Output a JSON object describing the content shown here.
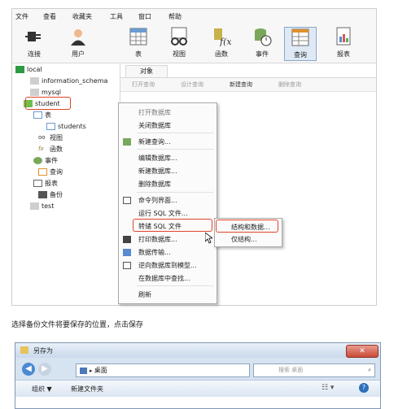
{
  "menubar": [
    "文件",
    "查看",
    "收藏夹",
    "工具",
    "窗口",
    "帮助"
  ],
  "toolbar": [
    {
      "label": "连接",
      "icon": "plug-icon"
    },
    {
      "label": "用户",
      "icon": "user-icon"
    },
    {
      "label": "表",
      "icon": "table-icon"
    },
    {
      "label": "视图",
      "icon": "view-icon"
    },
    {
      "label": "函数",
      "icon": "function-icon"
    },
    {
      "label": "事件",
      "icon": "event-icon"
    },
    {
      "label": "查询",
      "icon": "query-icon",
      "selected": true
    },
    {
      "label": "报表",
      "icon": "report-icon"
    }
  ],
  "tree": {
    "root": "local",
    "dbs": [
      "information_schema",
      "mysql",
      "student",
      "test"
    ],
    "student_children": [
      "表",
      "students",
      "视图",
      "函数",
      "事件",
      "查询",
      "报表",
      "备份"
    ]
  },
  "object_tab": "对象",
  "object_actions": [
    "打开查询",
    "设计查询",
    "新建查询",
    "删除查询"
  ],
  "context_menu": [
    "打开数据库",
    "关闭数据库",
    "新建查询...",
    "编辑数据库...",
    "新建数据库...",
    "删除数据库",
    "命令列界面...",
    "运行 SQL 文件...",
    "转储 SQL 文件",
    "打印数据库...",
    "数据传输...",
    "逆向数据库到模型...",
    "在数据库中查找...",
    "刷新"
  ],
  "submenu": [
    "结构和数据...",
    "仅结构..."
  ],
  "caption": "选择备份文件将要保存的位置，点击保存",
  "dialog": {
    "title": "另存为",
    "address": "桌面",
    "search_placeholder": "搜索 桌面",
    "organize": "组织 ▼",
    "new_folder": "新建文件夹"
  },
  "colors": {
    "highlight_border": "#e0452a",
    "selection": "#dfe9f5"
  }
}
